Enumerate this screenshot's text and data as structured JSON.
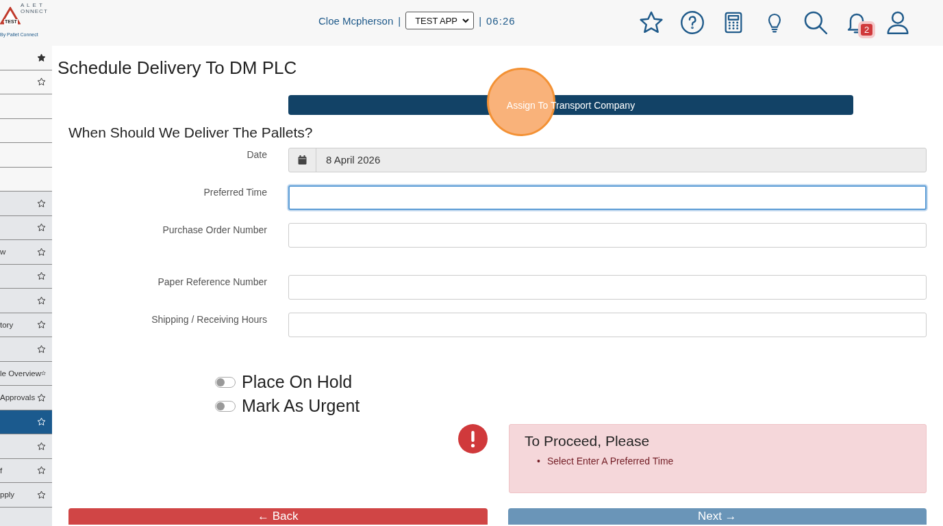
{
  "header": {
    "logo": {
      "lines": [
        "A L E T",
        "ONNECT"
      ],
      "badge": "TEST",
      "tagline": "By Pallet Connect"
    },
    "user": "Cloe Mcpherson",
    "separator_1": "|",
    "app_select": "TEST APP",
    "separator_2": "|",
    "time": "06:26",
    "notifications": "2"
  },
  "sidebar": {
    "items": [
      {
        "starred": true,
        "kind": "plain",
        "selected": false
      },
      {
        "starred": false,
        "kind": "plain",
        "selected": false
      },
      {
        "kind": "plain",
        "selected": false
      },
      {
        "kind": "plain",
        "selected": false
      },
      {
        "kind": "plain",
        "selected": false
      },
      {
        "kind": "plain",
        "selected": false
      },
      {
        "starred": false,
        "kind": "shaded",
        "selected": false
      },
      {
        "starred": false,
        "kind": "shaded",
        "selected": false
      },
      {
        "label": "w",
        "starred": false,
        "kind": "shaded",
        "selected": false
      },
      {
        "starred": false,
        "kind": "shaded",
        "selected": false
      },
      {
        "starred": false,
        "kind": "shaded",
        "selected": false
      },
      {
        "label": "tory",
        "starred": false,
        "kind": "shaded",
        "selected": false
      },
      {
        "starred": false,
        "kind": "shaded",
        "selected": false
      },
      {
        "label": "le Overview",
        "starred": false,
        "kind": "shaded",
        "selected": false
      },
      {
        "label": "Approvals",
        "starred": false,
        "kind": "shaded",
        "selected": false
      },
      {
        "starred": false,
        "kind": "shaded",
        "selected": true
      },
      {
        "starred": false,
        "kind": "shaded",
        "selected": false
      },
      {
        "label": "f",
        "starred": false,
        "kind": "shaded",
        "selected": false
      },
      {
        "label": "pply",
        "starred": false,
        "kind": "shaded",
        "selected": false
      },
      {
        "kind": "shaded",
        "selected": false
      }
    ]
  },
  "page": {
    "title": "Schedule Delivery To DM PLC",
    "step_button": "Assign To Transport Company",
    "click_highlight": true,
    "section_title": "When Should We Deliver The Pallets?",
    "fields": [
      {
        "label": "Date",
        "kind": "date",
        "value": "8 April 2026"
      },
      {
        "label": "Preferred Time",
        "kind": "text",
        "focused": true
      },
      {
        "label": "Purchase Order Number",
        "kind": "text",
        "focused": false
      },
      {
        "label": "Paper Reference Number",
        "kind": "text",
        "focused": false
      },
      {
        "label": "Shipping / Receiving Hours",
        "kind": "text",
        "focused": false
      }
    ],
    "toggles": [
      {
        "label": "Place On Hold",
        "on": false
      },
      {
        "label": "Mark As Urgent",
        "on": false
      }
    ],
    "alert": {
      "title": "To Proceed, Please",
      "items": [
        {
          "bullet": "•",
          "text": "Select Enter A Preferred Time"
        }
      ]
    },
    "back_button": "← Back",
    "next_button": "Next →"
  }
}
